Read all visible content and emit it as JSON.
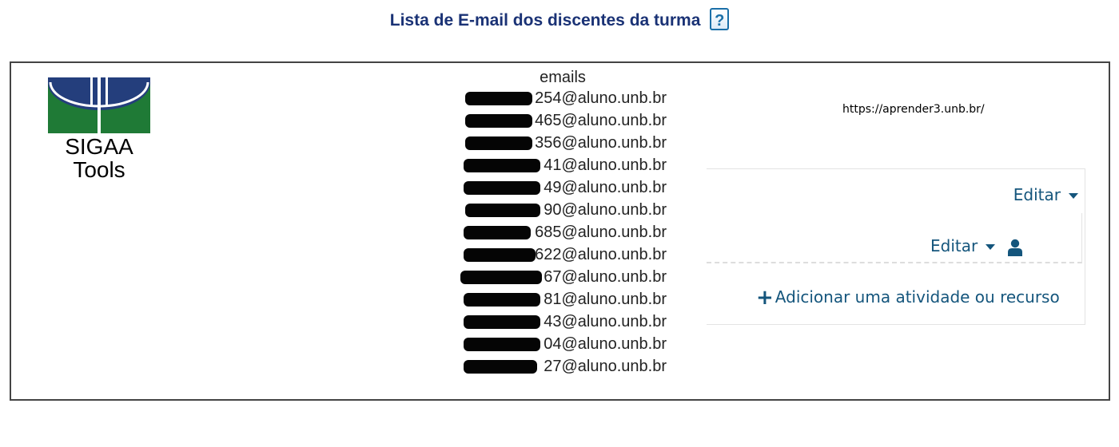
{
  "title": {
    "text": "Lista de E-mail dos discentes da turma",
    "help_icon": "question-mark-help-icon",
    "help_glyph": "?"
  },
  "logo": {
    "icon": "unb-logo-icon",
    "line1": "SIGAA",
    "line2": "Tools",
    "colors": {
      "navy": "#243e7c",
      "green": "#1f7a36"
    }
  },
  "emails": {
    "header": "emails",
    "rows": [
      "254@aluno.unb.br",
      "465@aluno.unb.br",
      "356@aluno.unb.br",
      "41@aluno.unb.br",
      "49@aluno.unb.br",
      "90@aluno.unb.br",
      "685@aluno.unb.br",
      "622@aluno.unb.br",
      "67@aluno.unb.br",
      "81@aluno.unb.br",
      "43@aluno.unb.br",
      "04@aluno.unb.br",
      "27@aluno.unb.br"
    ]
  },
  "url": "https://aprender3.unb.br/",
  "moodle": {
    "section_edit": "Editar",
    "activity_edit": "Editar",
    "add_activity": "Adicionar uma atividade ou recurso",
    "add_glyph": "+",
    "icons": {
      "caret": "caret-down-icon",
      "user": "user-icon",
      "plus": "plus-icon"
    },
    "link_color": "#14557c"
  }
}
